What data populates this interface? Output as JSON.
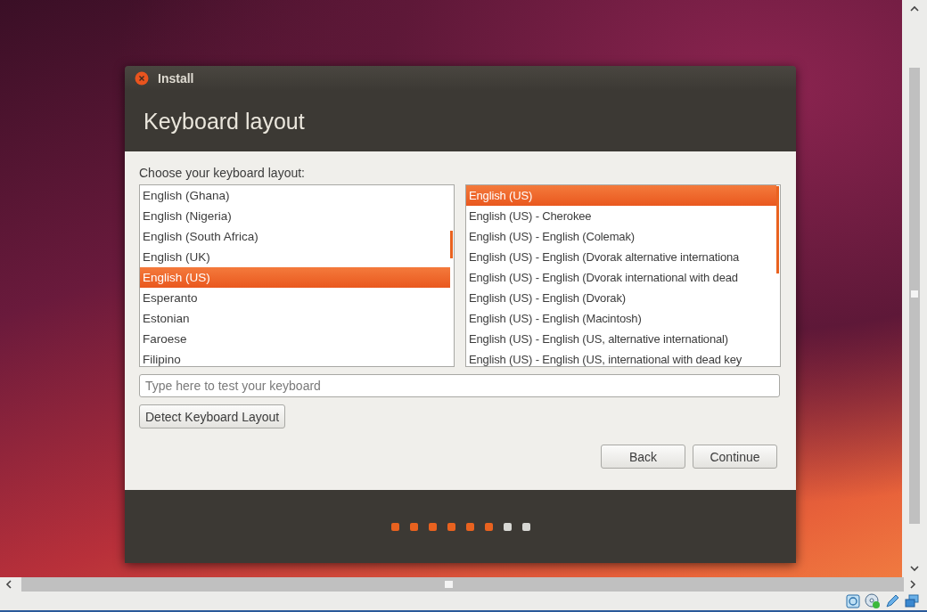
{
  "window": {
    "title": "Install"
  },
  "heading": "Keyboard layout",
  "prompt": "Choose your keyboard layout:",
  "layouts": [
    {
      "label": "English (Ghana)",
      "selected": false
    },
    {
      "label": "English (Nigeria)",
      "selected": false
    },
    {
      "label": "English (South Africa)",
      "selected": false
    },
    {
      "label": "English (UK)",
      "selected": false
    },
    {
      "label": "English (US)",
      "selected": true
    },
    {
      "label": "Esperanto",
      "selected": false
    },
    {
      "label": "Estonian",
      "selected": false
    },
    {
      "label": "Faroese",
      "selected": false
    },
    {
      "label": "Filipino",
      "selected": false
    }
  ],
  "variants": [
    {
      "label": "English (US)",
      "selected": true
    },
    {
      "label": "English (US) - Cherokee",
      "selected": false
    },
    {
      "label": "English (US) - English (Colemak)",
      "selected": false
    },
    {
      "label": "English (US) - English (Dvorak alternative internationa",
      "selected": false
    },
    {
      "label": "English (US) - English (Dvorak international with dead",
      "selected": false
    },
    {
      "label": "English (US) - English (Dvorak)",
      "selected": false
    },
    {
      "label": "English (US) - English (Macintosh)",
      "selected": false
    },
    {
      "label": "English (US) - English (US, alternative international)",
      "selected": false
    },
    {
      "label": "English (US) - English (US, international with dead key",
      "selected": false
    }
  ],
  "test_field": {
    "placeholder": "Type here to test your keyboard"
  },
  "detect_button": "Detect Keyboard Layout",
  "buttons": [
    "Back",
    "Continue"
  ],
  "progress": [
    {
      "done": true
    },
    {
      "done": true
    },
    {
      "done": true
    },
    {
      "done": true
    },
    {
      "done": true
    },
    {
      "done": true
    },
    {
      "done": false
    },
    {
      "done": false
    }
  ]
}
